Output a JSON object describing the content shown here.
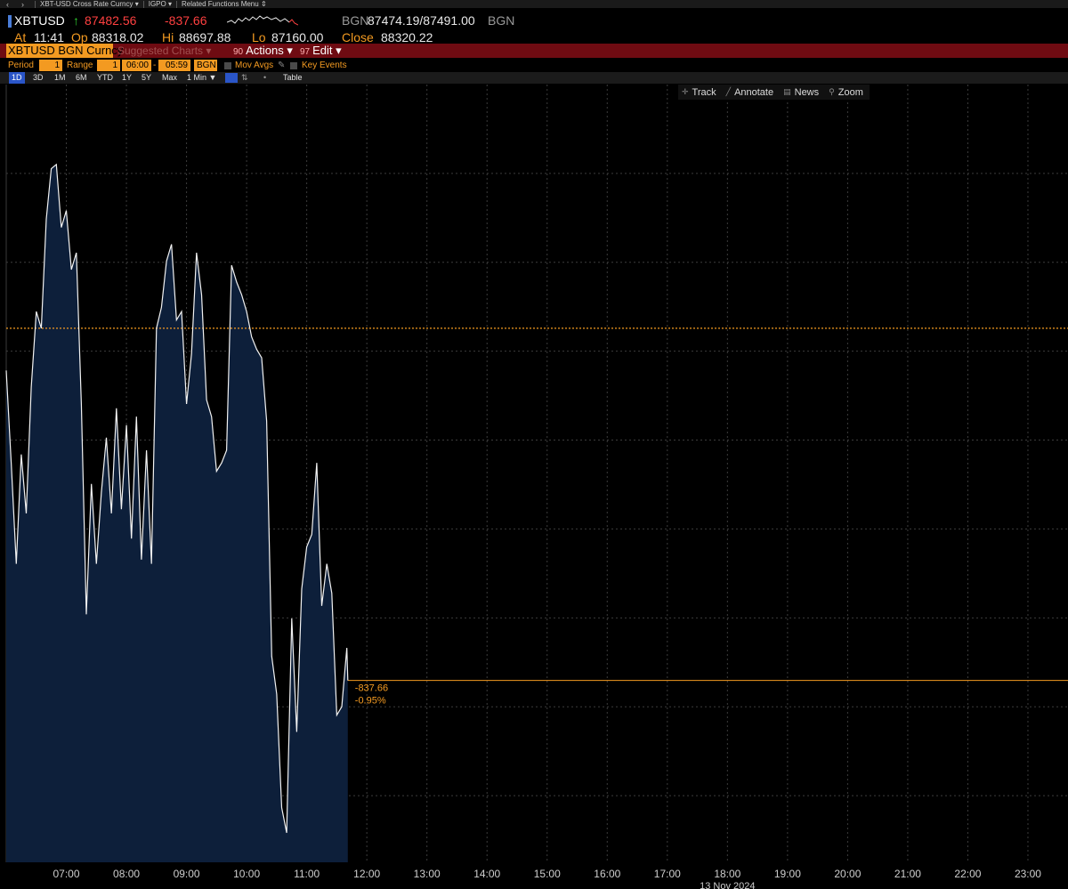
{
  "menu": {
    "security_desc": "XBT-USD Cross Rate Curncy",
    "function": "IGPO",
    "related": "Related Functions Menu"
  },
  "quote": {
    "ticker": "XBTUSD",
    "last": "87482.56",
    "change": "-837.66",
    "bgn_label": "BGN",
    "bid_ask": "87474.19/87491.00",
    "bgn_label2": "BGN",
    "at_label": "At",
    "time": "11:41",
    "open_label": "Op",
    "open": "88318.02",
    "hi_label": "Hi",
    "hi": "88697.88",
    "lo_label": "Lo",
    "lo": "87160.00",
    "close_label": "Close",
    "close": "88320.22"
  },
  "action_bar": {
    "security": "XBTUSD BGN Curncy",
    "suggested": "Suggested Charts",
    "actions_num": "90",
    "actions": "Actions",
    "edit_num": "97",
    "edit": "Edit"
  },
  "params": {
    "period_label": "Period",
    "period_value": "1",
    "range_label": "Range",
    "range_value": "1",
    "start_time": "06:00",
    "end_time": "05:59",
    "source": "BGN",
    "mov_avgs": "Mov Avgs",
    "key_events": "Key Events"
  },
  "intervals": {
    "items": [
      "1D",
      "3D",
      "1M",
      "6M",
      "YTD",
      "1Y",
      "5Y",
      "Max"
    ],
    "active": "1D",
    "frequency": "1 Min",
    "table": "Table"
  },
  "tools": {
    "track": "Track",
    "annotate": "Annotate",
    "news": "News",
    "zoom": "Zoom"
  },
  "colors": {
    "accent": "#f39a21",
    "action_bar": "#6f0b12",
    "down": "#ff4040",
    "price_line": "#f2f2f2",
    "area_fill": "#0d1f3a",
    "open_ref_line": "#f39a21"
  },
  "chart_data": {
    "type": "area",
    "series_name": "XBTUSD",
    "x_ticks": [
      "07:00",
      "08:00",
      "09:00",
      "10:00",
      "11:00",
      "12:00",
      "13:00",
      "14:00",
      "15:00",
      "16:00",
      "17:00",
      "18:00",
      "19:00",
      "20:00",
      "21:00",
      "22:00",
      "23:00"
    ],
    "date_label": "13 Nov 2024",
    "x_range": [
      "06:00",
      "23:40"
    ],
    "y_range": [
      87050,
      88900
    ],
    "grid": true,
    "reference_line": {
      "label": "Close",
      "value": 88320.22
    },
    "last_value_line": 87482.56,
    "last_change": "-837.66",
    "last_change_pct": "-0.95%",
    "x": [
      "06:00",
      "06:05",
      "06:10",
      "06:15",
      "06:20",
      "06:25",
      "06:30",
      "06:35",
      "06:40",
      "06:45",
      "06:50",
      "06:55",
      "07:00",
      "07:05",
      "07:10",
      "07:15",
      "07:20",
      "07:25",
      "07:30",
      "07:35",
      "07:40",
      "07:45",
      "07:50",
      "07:55",
      "08:00",
      "08:05",
      "08:10",
      "08:15",
      "08:20",
      "08:25",
      "08:30",
      "08:35",
      "08:40",
      "08:45",
      "08:50",
      "08:55",
      "09:00",
      "09:05",
      "09:10",
      "09:15",
      "09:20",
      "09:25",
      "09:30",
      "09:35",
      "09:40",
      "09:45",
      "09:50",
      "09:55",
      "10:00",
      "10:05",
      "10:10",
      "10:15",
      "10:20",
      "10:25",
      "10:30",
      "10:35",
      "10:40",
      "10:45",
      "10:50",
      "10:55",
      "11:00",
      "11:05",
      "11:10",
      "11:15",
      "11:20",
      "11:25",
      "11:30",
      "11:35",
      "11:40",
      "11:41"
    ],
    "y": [
      88220,
      88000,
      87760,
      88020,
      87880,
      88180,
      88360,
      88320,
      88580,
      88700,
      88710,
      88560,
      88600,
      88460,
      88500,
      88140,
      87640,
      87950,
      87760,
      87930,
      88060,
      87880,
      88130,
      87890,
      88090,
      87820,
      88110,
      87770,
      88030,
      87760,
      88320,
      88370,
      88480,
      88520,
      88340,
      88360,
      88140,
      88260,
      88500,
      88400,
      88150,
      88110,
      87980,
      88000,
      88030,
      88470,
      88430,
      88400,
      88360,
      88300,
      88270,
      88250,
      88100,
      87540,
      87450,
      87180,
      87120,
      87630,
      87360,
      87700,
      87800,
      87830,
      88000,
      87660,
      87760,
      87690,
      87400,
      87420,
      87560,
      87482.56
    ]
  }
}
